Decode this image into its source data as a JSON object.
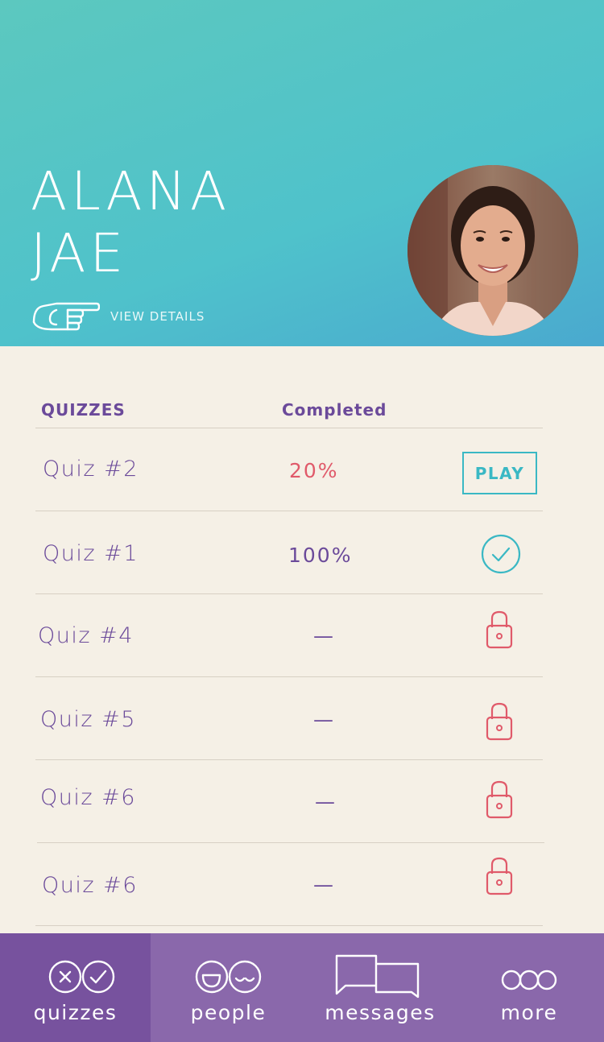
{
  "profile": {
    "first_name": "ALANA",
    "last_name": "JAE",
    "view_details_label": "VIEW DETAILS"
  },
  "table": {
    "headers": {
      "quizzes": "QUIZZES",
      "completed": "Completed"
    },
    "rows": [
      {
        "name": "Quiz #2",
        "completed": "20%",
        "status": "play",
        "action_label": "PLAY"
      },
      {
        "name": "Quiz #1",
        "completed": "100%",
        "status": "done"
      },
      {
        "name": "Quiz #4",
        "completed": "—",
        "status": "locked"
      },
      {
        "name": "Quiz #5",
        "completed": "—",
        "status": "locked"
      },
      {
        "name": "Quiz #6",
        "completed": "—",
        "status": "locked"
      },
      {
        "name": "Quiz #6",
        "completed": "—",
        "status": "locked"
      }
    ]
  },
  "tabs": [
    {
      "label": "quizzes",
      "icon": "quizzes-icon",
      "active": true
    },
    {
      "label": "people",
      "icon": "people-icon",
      "active": false
    },
    {
      "label": "messages",
      "icon": "messages-icon",
      "active": false
    },
    {
      "label": "more",
      "icon": "more-icon",
      "active": false
    }
  ],
  "colors": {
    "header_teal": "#4fc2cb",
    "accent_purple": "#6b4a9a",
    "accent_cyan": "#3ab8c4",
    "alert_red": "#e05a6a",
    "background": "#f5f0e6",
    "tabbar": "#8a68ab",
    "tab_active": "#77529e"
  }
}
